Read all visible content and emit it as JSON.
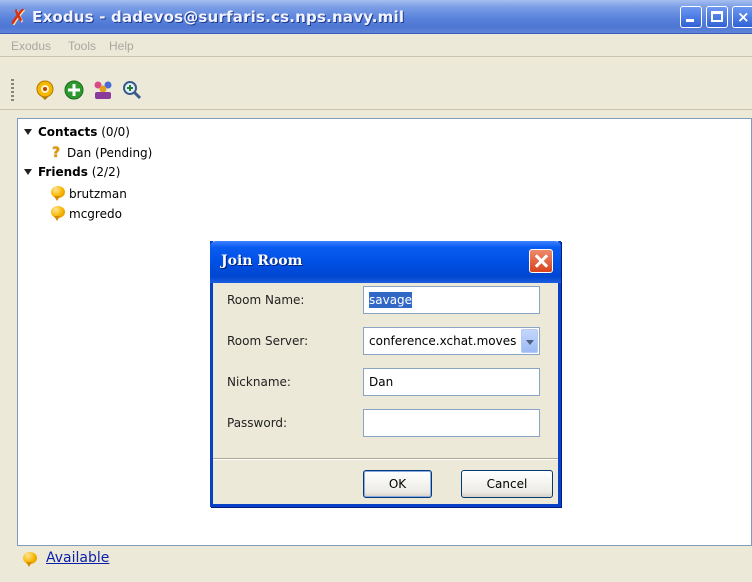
{
  "window": {
    "title": "Exodus - dadevos@surfaris.cs.nps.navy.mil",
    "app_icon": "exodus-x-icon"
  },
  "menu": {
    "items": [
      "Exodus",
      "Tools",
      "Help"
    ]
  },
  "toolbar": {
    "icons": [
      "presence-icon",
      "add-contact-icon",
      "join-room-icon",
      "search-icon"
    ]
  },
  "contacts": {
    "groups": [
      {
        "name": "Contacts",
        "count": "(0/0)",
        "members": [
          {
            "name": "Dan (Pending)",
            "icon": "pending-question-icon"
          }
        ]
      },
      {
        "name": "Friends",
        "count": "(2/2)",
        "members": [
          {
            "name": "brutzman",
            "icon": "available-bulb-icon"
          },
          {
            "name": "mcgredo",
            "icon": "available-bulb-icon"
          }
        ]
      }
    ]
  },
  "status": {
    "label": "Available",
    "icon": "available-bulb-icon"
  },
  "dialog": {
    "title": "Join Room",
    "fields": {
      "room_name": {
        "label": "Room Name:",
        "value": "savage"
      },
      "room_server": {
        "label": "Room Server:",
        "value": "conference.xchat.moves"
      },
      "nickname": {
        "label": "Nickname:",
        "value": "Dan"
      },
      "password": {
        "label": "Password:",
        "value": ""
      }
    },
    "buttons": {
      "ok": "OK",
      "cancel": "Cancel"
    }
  },
  "colors": {
    "titlebar_blue": "#5a83dc",
    "dialog_titlebar_blue": "#0050e4",
    "window_bg": "#ece9d8",
    "link_blue": "#0c1fa8",
    "selection_blue": "#3168c6"
  }
}
